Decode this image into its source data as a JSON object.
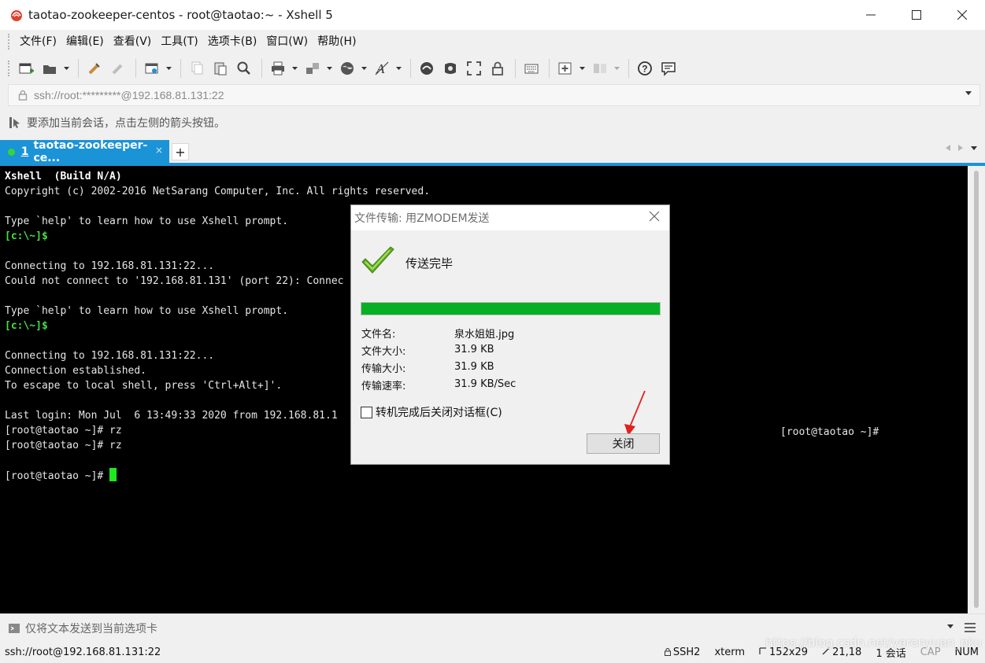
{
  "window": {
    "title": "taotao-zookeeper-centos - root@taotao:~ - Xshell 5"
  },
  "menu": {
    "items": [
      "文件(F)",
      "编辑(E)",
      "查看(V)",
      "工具(T)",
      "选项卡(B)",
      "窗口(W)",
      "帮助(H)"
    ]
  },
  "address": {
    "value": "ssh://root:*********@192.168.81.131:22"
  },
  "hint": {
    "text": "要添加当前会话，点击左侧的箭头按钮。"
  },
  "tabs": {
    "active": {
      "number": "1",
      "label": "taotao-zookeeper-ce...",
      "close": "×"
    },
    "add": "+"
  },
  "terminal": {
    "lines": [
      "Xshell  (Build N/A)",
      "Copyright (c) 2002-2016 NetSarang Computer, Inc. All rights reserved.",
      "",
      "Type `help' to learn how to use Xshell prompt.",
      "[c:\\~]$",
      "",
      "Connecting to 192.168.81.131:22...",
      "Could not connect to '192.168.81.131' (port 22): Connec",
      "",
      "Type `help' to learn how to use Xshell prompt.",
      "[c:\\~]$",
      "",
      "Connecting to 192.168.81.131:22...",
      "Connection established.",
      "To escape to local shell, press 'Ctrl+Alt+]'.",
      "",
      "Last login: Mon Jul  6 13:49:33 2020 from 192.168.81.1",
      "[root@taotao ~]# rz",
      "[root@taotao ~]# rz",
      "",
      "[root@taotao ~]# "
    ],
    "right_prompt": "[root@taotao ~]#"
  },
  "sendbar": {
    "text": "仅将文本发送到当前选项卡"
  },
  "status": {
    "session": "ssh://root@192.168.81.131:22",
    "protocol": "SSH2",
    "term": "xterm",
    "size": "152x29",
    "pos": "21,18",
    "sessions": "1 会话",
    "cap": "CAP",
    "num": "NUM"
  },
  "dialog": {
    "title": "文件传输: 用ZMODEM发送",
    "status": "传送完毕",
    "progress_percent": 100,
    "rows": [
      {
        "label": "文件名:",
        "value": "泉水姐姐.jpg"
      },
      {
        "label": "文件大小:",
        "value": "31.9 KB"
      },
      {
        "label": "传输大小:",
        "value": "31.9 KB"
      },
      {
        "label": "传输速率:",
        "value": "31.9 KB/Sec"
      }
    ],
    "checkbox_label": "转机完成后关闭对话框(C)",
    "checkbox_checked": false,
    "close_button": "关闭"
  },
  "watermark": "https://blog.csdn.net/yerenyuan_pku",
  "colors": {
    "accent": "#1b93d7",
    "progress": "#06b025",
    "terminal_bg": "#000000",
    "prompt": "#45e045"
  }
}
